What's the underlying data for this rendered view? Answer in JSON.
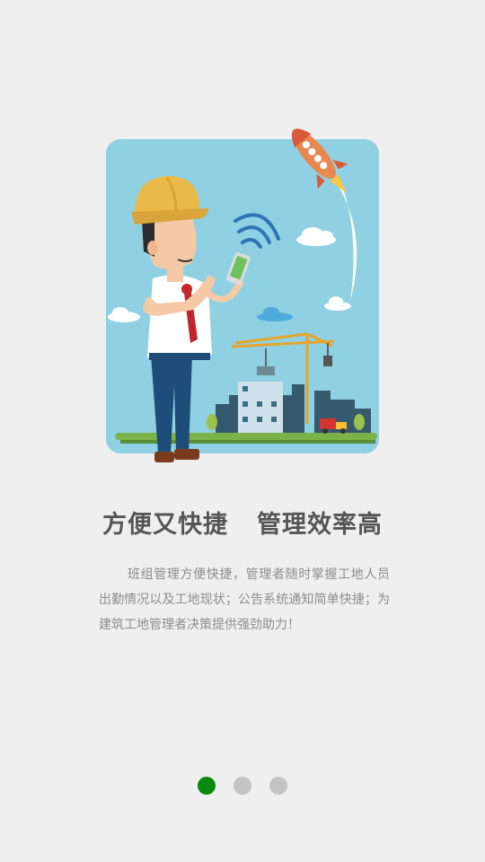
{
  "guide": {
    "headline_left": "方便又快捷",
    "headline_right": "管理效率高",
    "description": "班组管理方便快捷，管理者随时掌握工地人员出勤情况以及工地现状；公告系统通知简单快捷；为建筑工地管理者决策提供强劲助力！"
  },
  "pager": {
    "pages": 3,
    "active_index": 0,
    "active_color": "#0a8a10",
    "inactive_color": "#c3c3c3"
  },
  "colors": {
    "background": "#efefef",
    "sky": "#8fd0e3",
    "helmet": "#e9b94a"
  }
}
